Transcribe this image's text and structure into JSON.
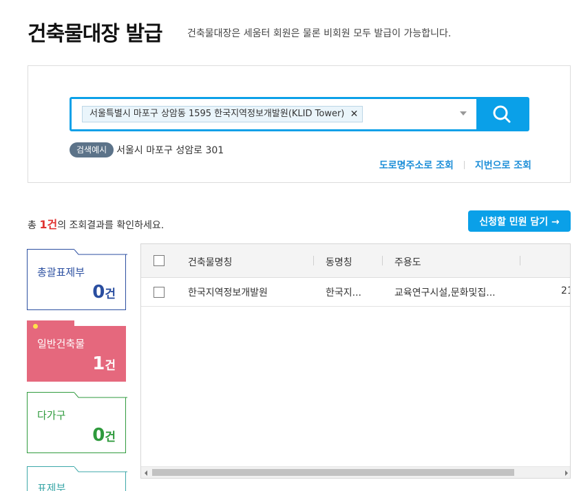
{
  "header": {
    "title": "건축물대장 발급",
    "subtitle": "건축물대장은 세움터 회원은 물론 비회원 모두 발급이 가능합니다."
  },
  "search": {
    "selected_address": "서울특별시 마포구 상암동 1595 한국지역정보개발원(KLID Tower)",
    "chip_close": "✕",
    "example_badge": "검색예시",
    "example_text": "서울시 마포구 성암로 301",
    "road_lookup": "도로명주소로 조회",
    "lot_lookup": "지번으로 조회",
    "icon": "search-icon"
  },
  "results": {
    "prefix": "총 ",
    "count": "1건",
    "suffix": "의 조회결과를 확인하세요.",
    "apply_button": "신청할 민원 담기 →"
  },
  "categories": [
    {
      "label": "총괄표제부",
      "count": "0",
      "unit": "건",
      "color": "#2a4ea0",
      "active": false
    },
    {
      "label": "일반건축물",
      "count": "1",
      "unit": "건",
      "color": "#e5687d",
      "active": true
    },
    {
      "label": "다가구",
      "count": "0",
      "unit": "건",
      "color": "#2e9a3c",
      "active": false
    },
    {
      "label": "표제부",
      "count": "",
      "unit": "",
      "color": "#3ba7a8",
      "active": false
    }
  ],
  "table": {
    "columns": [
      "건축물명칭",
      "동명칭",
      "주용도"
    ],
    "rows": [
      {
        "name": "한국지역정보개발원",
        "dong": "한국지...",
        "use": "교육연구시설,문화및집...",
        "extra": "21"
      }
    ]
  },
  "colors": {
    "accent": "#0aa0e8",
    "link": "#1e8fd8",
    "count_red": "#e0312f"
  }
}
